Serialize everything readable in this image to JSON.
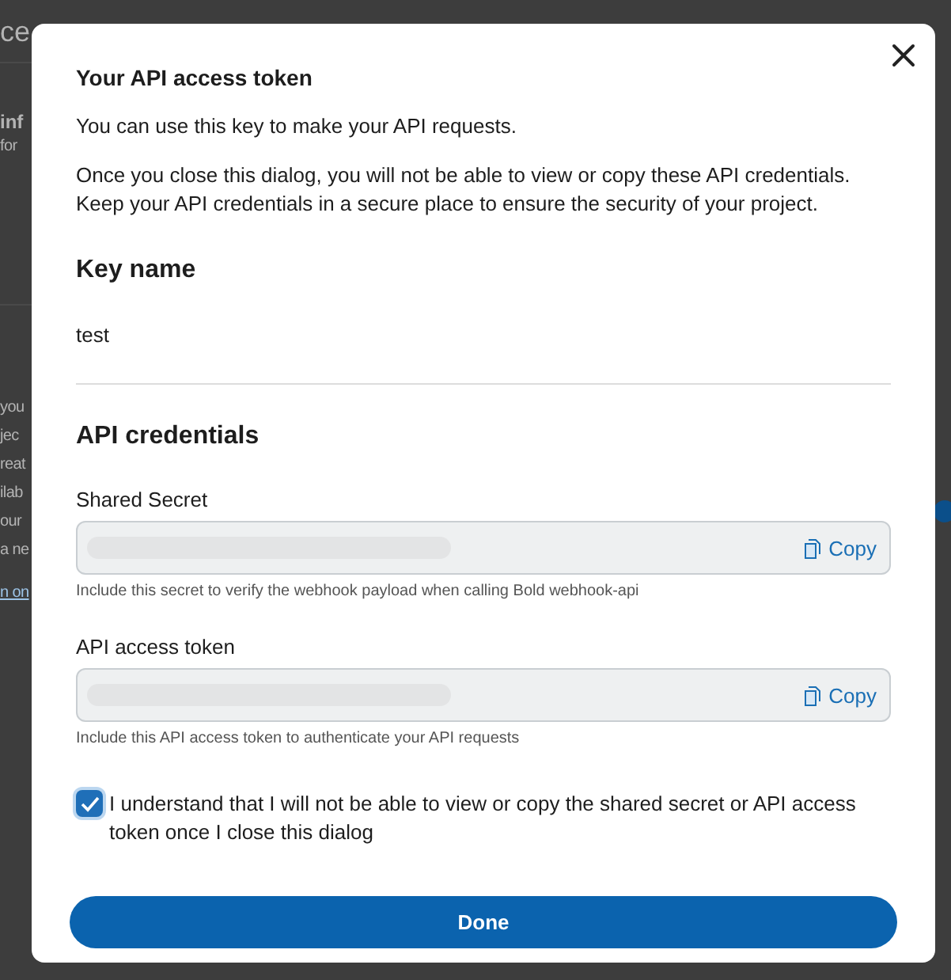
{
  "background": {
    "sections": [
      {
        "items": [
          {
            "text": "ce",
            "kind": "heading"
          }
        ]
      },
      {
        "items": [
          {
            "text": "inf",
            "kind": "subheading"
          },
          {
            "text": "for",
            "kind": "body"
          }
        ]
      },
      {
        "items": [
          {
            "text": "you",
            "kind": "body"
          },
          {
            "text": "jec",
            "kind": "body"
          },
          {
            "text": "reat",
            "kind": "body"
          },
          {
            "text": "ilab",
            "kind": "body"
          },
          {
            "text": "our",
            "kind": "body"
          },
          {
            "text": "a ne",
            "kind": "body"
          },
          {
            "text": "n on",
            "kind": "link"
          }
        ]
      }
    ]
  },
  "dialog": {
    "title": "Your API access token",
    "intro": "You can use this key to make your API requests.",
    "warning": "Once you close this dialog, you will not be able to view or copy these API credentials. Keep your API credentials in a secure place to ensure the security of your project.",
    "key_section": {
      "heading": "Key name",
      "value": "test"
    },
    "credentials_section": {
      "heading": "API credentials",
      "fields": [
        {
          "label": "Shared Secret",
          "button": "Copy",
          "hint": "Include this secret to verify the webhook payload when calling Bold webhook-api"
        },
        {
          "label": "API access token",
          "button": "Copy",
          "hint": "Include this API access token to authenticate your API requests"
        }
      ]
    },
    "acknowledge": {
      "label": "I understand that I will not be able to view or copy the shared secret or API access token once I close this dialog",
      "checked": true
    },
    "done_button": "Done"
  }
}
